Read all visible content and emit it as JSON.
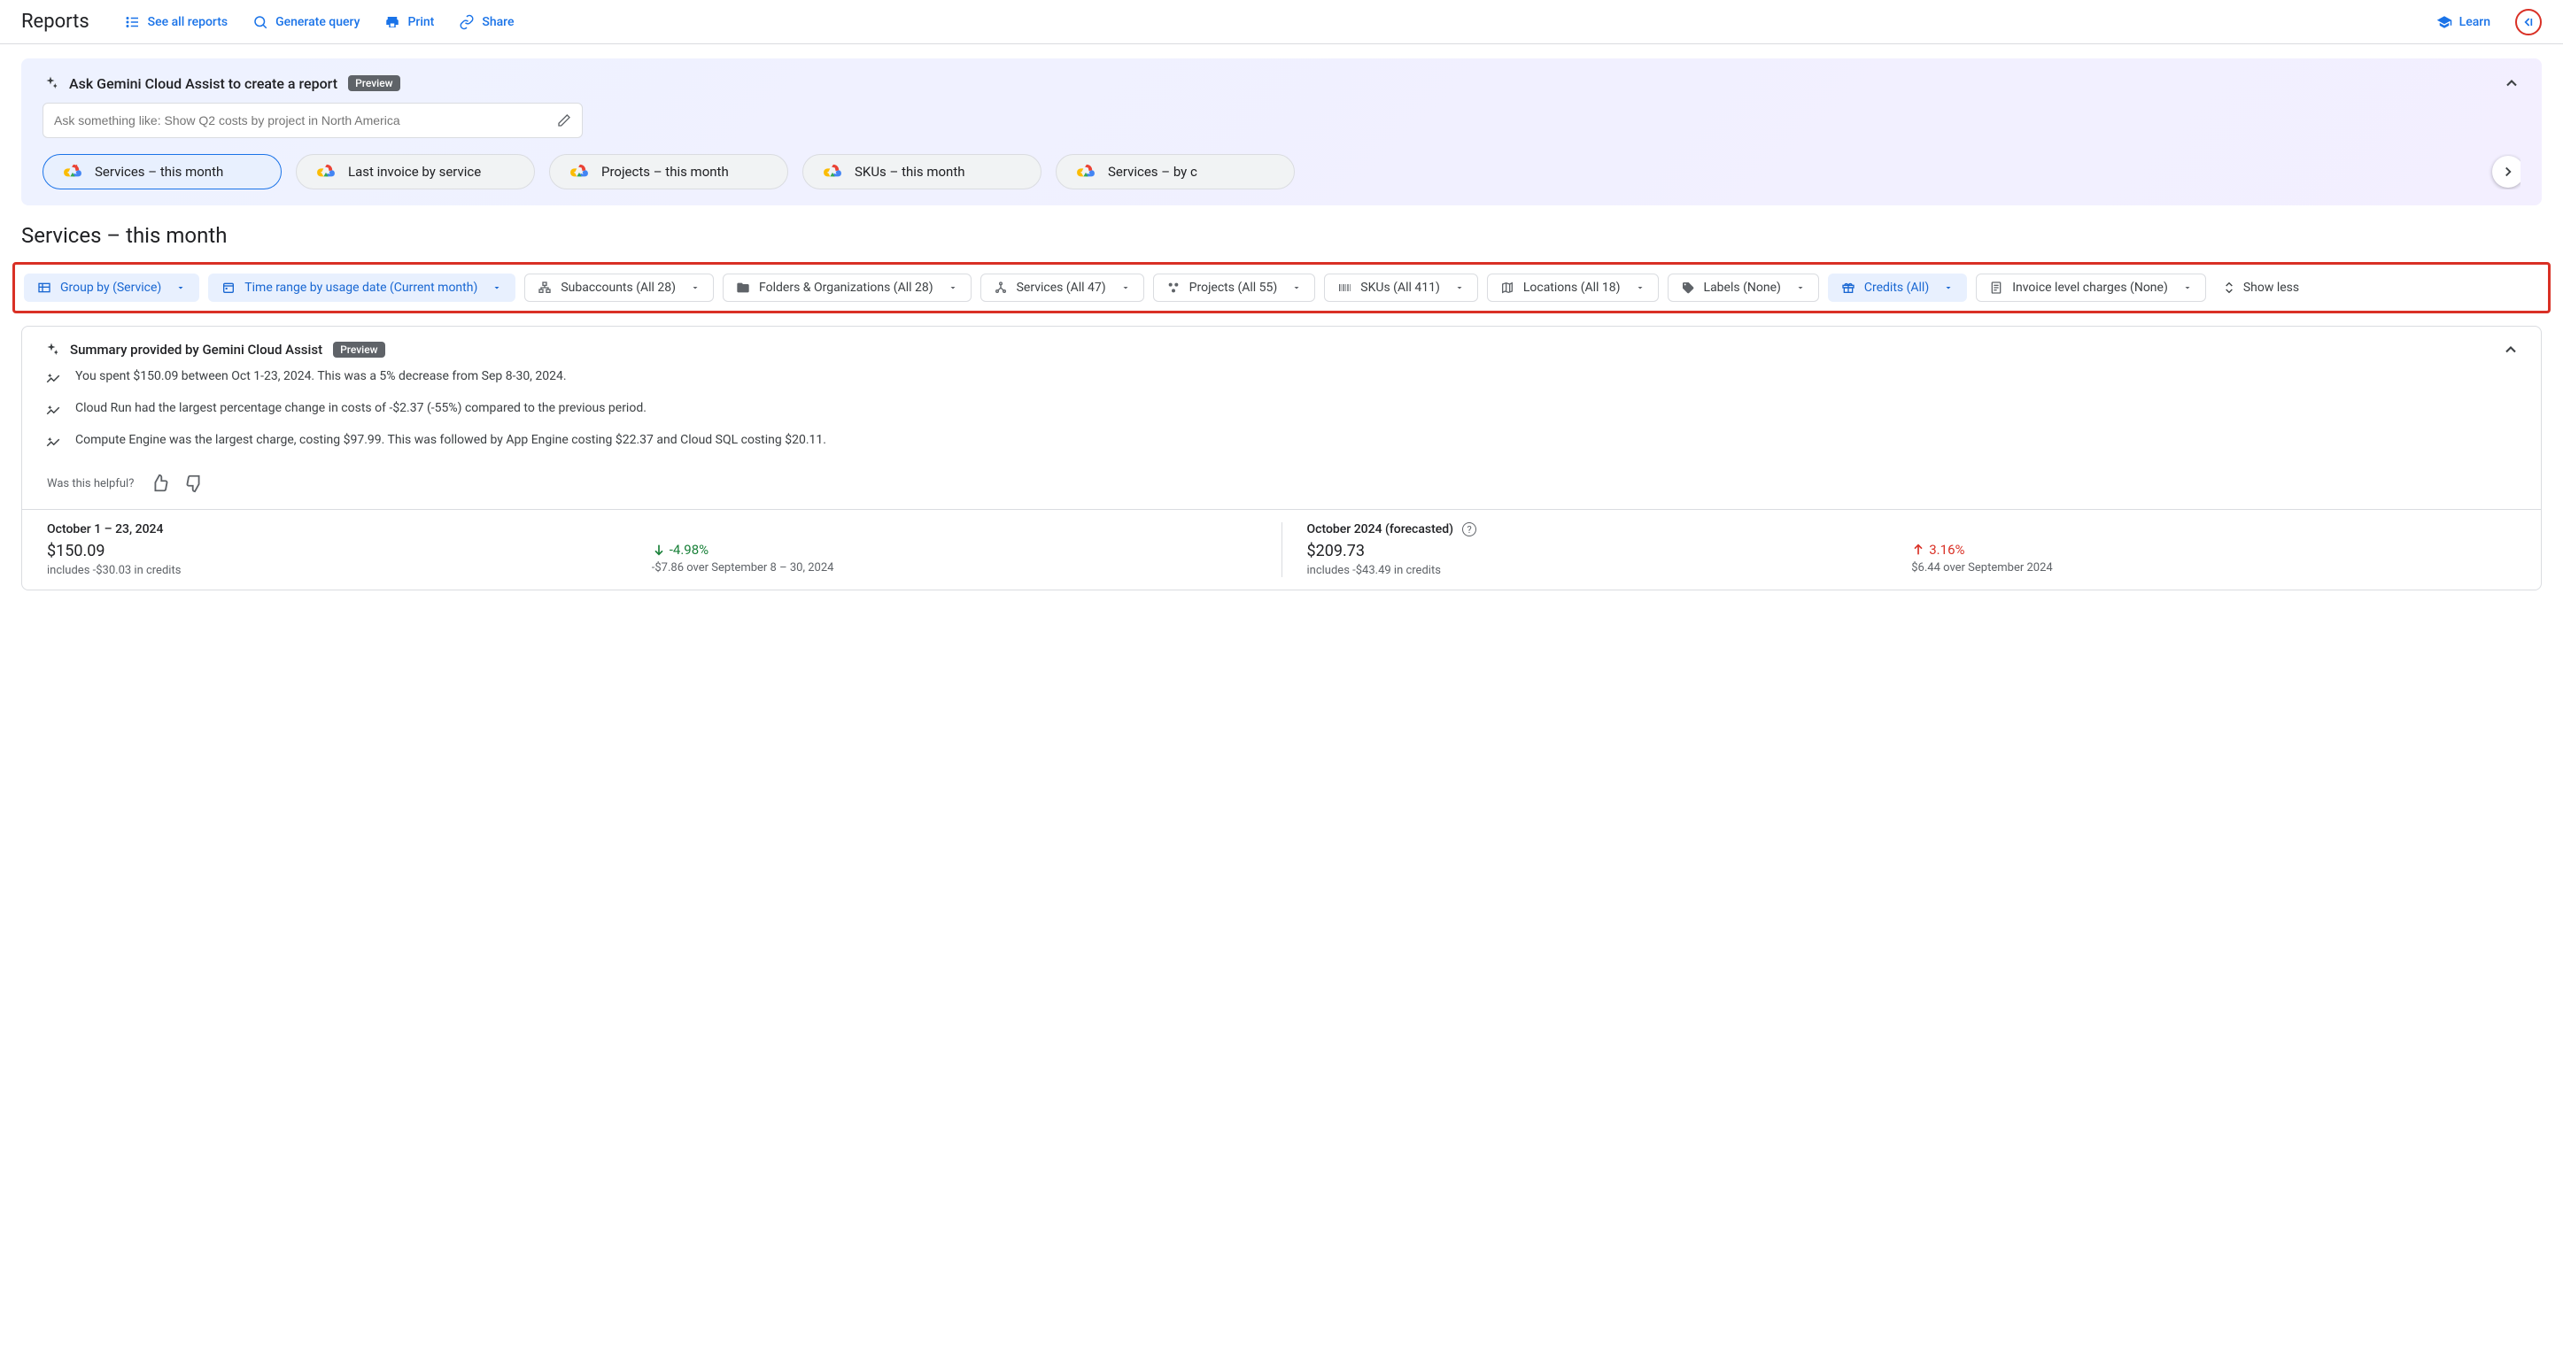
{
  "header": {
    "title": "Reports",
    "see_all": "See all reports",
    "generate": "Generate query",
    "print": "Print",
    "share": "Share",
    "learn": "Learn"
  },
  "gemini": {
    "title": "Ask Gemini Cloud Assist to create a report",
    "preview": "Preview",
    "placeholder": "Ask something like: Show Q2 costs by project in North America",
    "chips": [
      "Services – this month",
      "Last invoice by service",
      "Projects – this month",
      "SKUs – this month",
      "Services – by c"
    ]
  },
  "report": {
    "title": "Services – this month"
  },
  "filters": {
    "group_by": "Group by (Service)",
    "time_range": "Time range by usage date (Current month)",
    "subaccounts": "Subaccounts (All 28)",
    "folders": "Folders & Organizations (All 28)",
    "services": "Services (All 47)",
    "projects": "Projects (All 55)",
    "skus": "SKUs (All 411)",
    "locations": "Locations (All 18)",
    "labels": "Labels (None)",
    "credits": "Credits (All)",
    "invoice": "Invoice level charges (None)",
    "show_less": "Show less"
  },
  "summary": {
    "title": "Summary provided by Gemini Cloud Assist",
    "preview": "Preview",
    "insights": [
      "You spent $150.09 between Oct 1-23, 2024. This was a 5% decrease from Sep 8-30, 2024.",
      "Cloud Run had the largest percentage change in costs of -$2.37 (-55%) compared to the previous period.",
      "Compute Engine was the largest charge, costing $97.99. This was followed by App Engine costing $22.37 and Cloud SQL costing $20.11."
    ],
    "feedback": "Was this helpful?"
  },
  "kpi": {
    "actual": {
      "label": "October 1 – 23, 2024",
      "value": "$150.09",
      "credits": "includes -$30.03 in credits",
      "delta": "-4.98%",
      "delta_detail": "-$7.86 over September 8 – 30, 2024"
    },
    "forecast": {
      "label": "October 2024 (forecasted)",
      "value": "$209.73",
      "credits": "includes -$43.49 in credits",
      "delta": "3.16%",
      "delta_detail": "$6.44 over September 2024"
    }
  }
}
